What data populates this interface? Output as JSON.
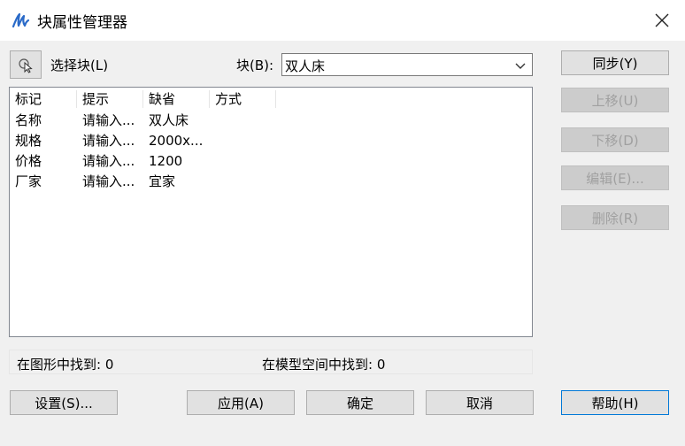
{
  "window": {
    "title": "块属性管理器"
  },
  "toolbar": {
    "pick_label": "选择块(L)",
    "block_label": "块(B):",
    "block_value": "双人床"
  },
  "list": {
    "columns": [
      "标记",
      "提示",
      "缺省",
      "方式"
    ],
    "rows": [
      [
        "名称",
        "请输入...",
        "双人床",
        ""
      ],
      [
        "规格",
        "请输入...",
        "2000x...",
        ""
      ],
      [
        "价格",
        "请输入...",
        "1200",
        ""
      ],
      [
        "厂家",
        "请输入...",
        "宜家",
        ""
      ]
    ]
  },
  "status": {
    "found_in_drawing": "在图形中找到: 0",
    "found_in_model_space": "在模型空间中找到: 0"
  },
  "side_buttons": {
    "sync": "同步(Y)",
    "move_up": "上移(U)",
    "move_down": "下移(D)",
    "edit": "编辑(E)...",
    "delete": "删除(R)"
  },
  "bottom_buttons": {
    "settings": "设置(S)...",
    "apply": "应用(A)",
    "ok": "确定",
    "cancel": "取消",
    "help": "帮助(H)"
  }
}
